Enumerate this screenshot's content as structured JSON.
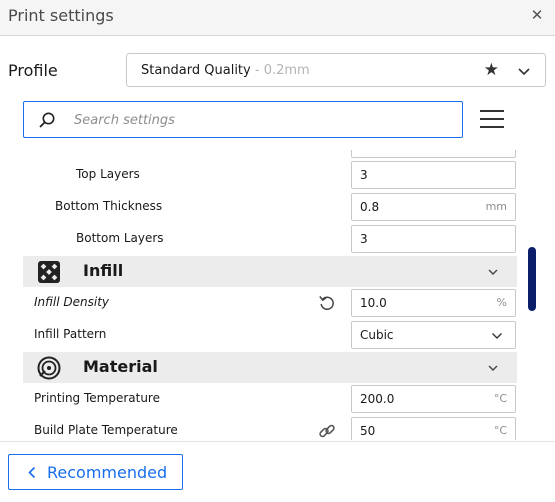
{
  "window": {
    "title": "Print settings",
    "close_icon": "close-icon"
  },
  "profile": {
    "label": "Profile",
    "selected_name": "Standard Quality",
    "selected_sub": " - 0.2mm",
    "favorite_icon": "star-icon",
    "dropdown_icon": "chevron-down-icon"
  },
  "search": {
    "placeholder": "Search settings",
    "value": ""
  },
  "settings": {
    "top_layers": {
      "label": "Top Layers",
      "value": "3"
    },
    "bottom_thickness": {
      "label": "Bottom Thickness",
      "value": "0.8",
      "unit": "mm"
    },
    "bottom_layers": {
      "label": "Bottom Layers",
      "value": "3"
    },
    "infill": {
      "title": "Infill",
      "density": {
        "label": "Infill Density",
        "value": "10.0",
        "unit": "%"
      },
      "pattern": {
        "label": "Infill Pattern",
        "value": "Cubic"
      }
    },
    "material": {
      "title": "Material",
      "print_temp": {
        "label": "Printing Temperature",
        "value": "200.0",
        "unit": "°C"
      },
      "plate_temp": {
        "label": "Build Plate Temperature",
        "value": "50",
        "unit": "°C"
      }
    }
  },
  "footer": {
    "recommended_label": "Recommended"
  },
  "colors": {
    "accent": "#196ef0",
    "category_bg": "#ececec",
    "scrollbar": "#0a1e6a"
  }
}
